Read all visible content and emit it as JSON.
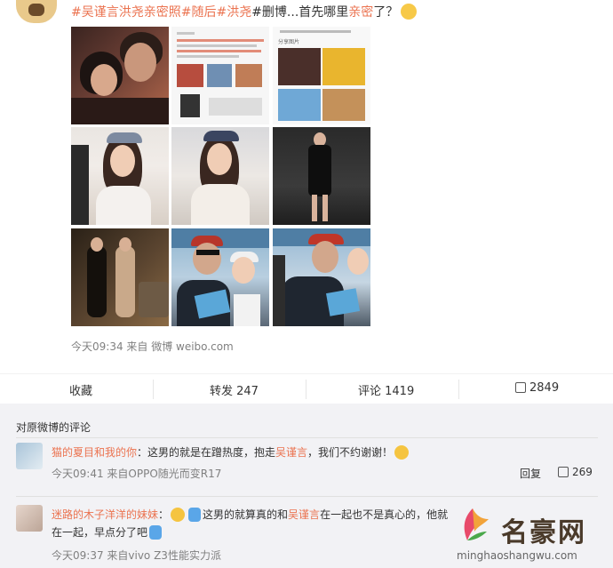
{
  "post": {
    "text_parts": [
      "#",
      "吴谨言洪尧亲密照",
      "#随后",
      "#洪尧",
      "#删博...首先哪里",
      "亲密",
      "了？"
    ],
    "preview_header": "分享图片",
    "meta": "今天09:34 来自 微博 weibo.com"
  },
  "actions": {
    "favorite": "收藏",
    "repost": "转发 247",
    "comment": "评论 1419",
    "like": "2849"
  },
  "comments_section": {
    "title": "对原微博的评论",
    "items": [
      {
        "user": "猫的夏目和我的你",
        "text_a": "：这男的就是在蹭热度，抱走",
        "mention": "吴谨言",
        "text_b": "，我们不约谢谢！",
        "meta": "今天09:41 来自OPPO随光而变R17",
        "reply": "回复",
        "likes": "269"
      },
      {
        "user": "迷路的木子洋洋的妹妹",
        "text_a": "这男的就算真的和",
        "mention": "吴谨言",
        "text_b": "在一起也不是真心的，他就",
        "line2": "在一起，早点分了吧",
        "meta": "今天09:37 来自vivo Z3性能实力派"
      }
    ]
  },
  "watermark": {
    "name": "名豪网",
    "url": "minghaoshangwu.com"
  },
  "colors": {
    "accent": "#eb7350",
    "page_bg": "#f2f2f5"
  }
}
